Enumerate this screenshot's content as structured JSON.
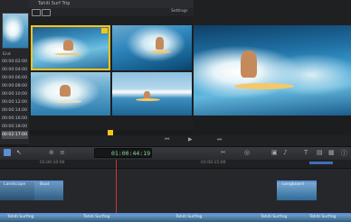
{
  "viewer": {
    "title": "Tahiti Surf Trip",
    "settings_label": "Settings"
  },
  "timecodes": [
    "00:00:02:00",
    "00:00:04:00",
    "00:00:06:00",
    "00:00:08:00",
    "00:00:10:00",
    "00:00:12:00",
    "00:00:14:00",
    "00:00:16:00",
    "00:00:18:00",
    "00:02:17:00"
  ],
  "event_label": "End",
  "toolbar": {
    "timecode": "01:00:44:19"
  },
  "ruler": {
    "left_mark": "01:00:10:00",
    "right_mark": "01:00:15:00"
  },
  "timeline": {
    "upper_clips": [
      "Landscape",
      "Boat",
      "Longboard"
    ],
    "track_labels": [
      "Tahiti Surfing",
      "Tahiti Surfing",
      "Tahiti Surfing",
      "Tahiti Surfing",
      "Tahiti Surfing"
    ]
  },
  "colors": {
    "accent": "#f5c518",
    "playhead": "#c7382f",
    "selection_blue": "#5b8fd8"
  }
}
